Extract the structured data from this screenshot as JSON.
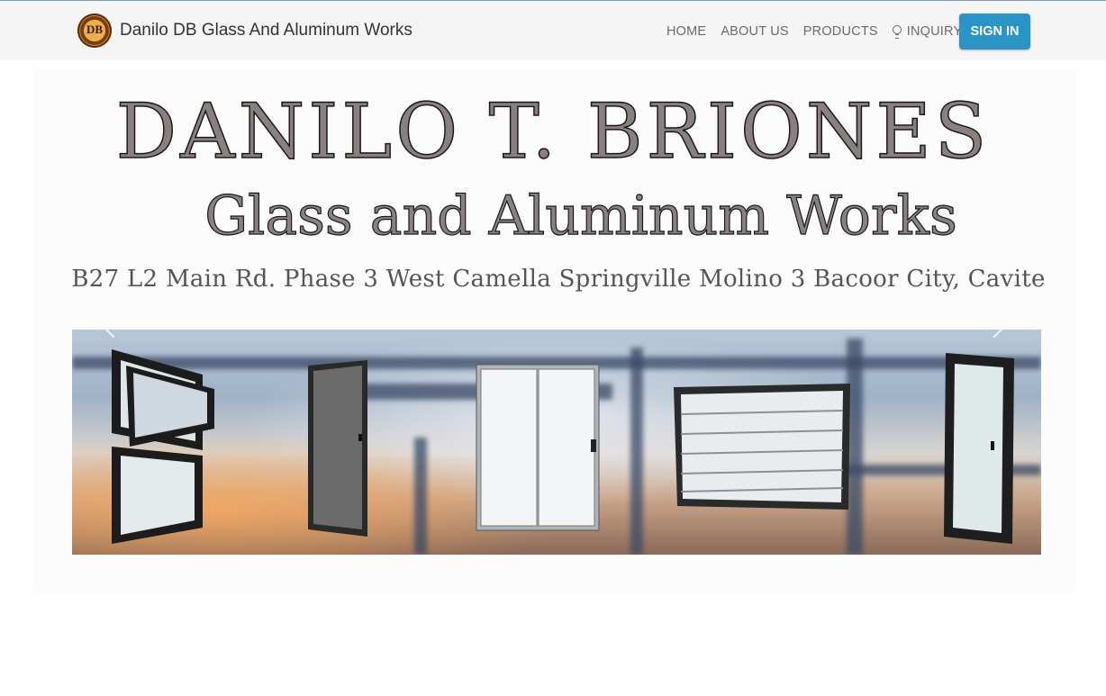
{
  "navbar": {
    "logo_text": "DB",
    "brand": "Danilo DB Glass And Aluminum Works",
    "links": [
      "HOME",
      "ABOUT US",
      "PRODUCTS",
      "INQUIRY"
    ],
    "signin": "SIGN IN"
  },
  "hero": {
    "title": "DANILO T. BRIONES",
    "subtitle": "Glass and Aluminum Works",
    "address": "B27 L2 Main Rd. Phase 3 West Camella Springville Molino 3 Bacoor City, Cavite"
  },
  "carousel": {
    "prev_icon": "chevron-left-icon",
    "next_icon": "chevron-right-icon"
  },
  "colors": {
    "signin_bg": "#2b94c6",
    "navbar_bg": "#f5f5f5"
  }
}
